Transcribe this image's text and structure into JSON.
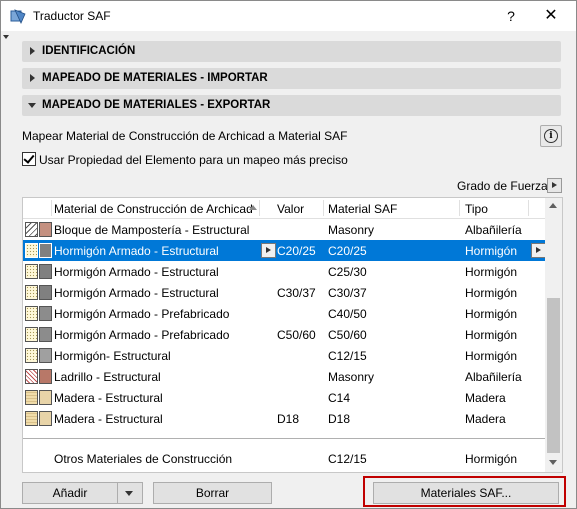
{
  "window": {
    "title": "Traductor SAF",
    "help_label": "?",
    "close_label": "✕"
  },
  "sections": [
    {
      "label": "IDENTIFICACIÓN",
      "expanded": false
    },
    {
      "label": "MAPEADO DE MATERIALES - IMPORTAR",
      "expanded": false
    },
    {
      "label": "MAPEADO DE MATERIALES - EXPORTAR",
      "expanded": true
    }
  ],
  "export": {
    "description": "Mapear Material de Construcción de Archicad a Material SAF",
    "info_icon": "i",
    "checkbox_label": "Usar Propiedad del Elemento para un mapeo más preciso",
    "checkbox_checked": true,
    "grado_label": "Grado de Fuerza"
  },
  "table": {
    "headers": {
      "material": "Material de Construcción de Archicad",
      "valor": "Valor",
      "saf": "Material SAF",
      "tipo": "Tipo"
    },
    "rows": [
      {
        "material": "Bloque de Mampostería - Estructural",
        "valor": "",
        "saf": "Masonry",
        "tipo": "Albañilería",
        "fill": "hatch",
        "color": "#c49080"
      },
      {
        "material": "Hormigón Armado - Estructural",
        "valor": "C20/25",
        "saf": "C20/25",
        "tipo": "Hormigón",
        "fill": "dots",
        "color": "#808080",
        "selected": true
      },
      {
        "material": "Hormigón Armado - Estructural",
        "valor": "",
        "saf": "C25/30",
        "tipo": "Hormigón",
        "fill": "dots",
        "color": "#808080"
      },
      {
        "material": "Hormigón Armado - Estructural",
        "valor": "C30/37",
        "saf": "C30/37",
        "tipo": "Hormigón",
        "fill": "dots",
        "color": "#808080"
      },
      {
        "material": "Hormigón Armado - Prefabricado",
        "valor": "",
        "saf": "C40/50",
        "tipo": "Hormigón",
        "fill": "dots",
        "color": "#8c8c8c"
      },
      {
        "material": "Hormigón Armado - Prefabricado",
        "valor": "C50/60",
        "saf": "C50/60",
        "tipo": "Hormigón",
        "fill": "dots",
        "color": "#8c8c8c"
      },
      {
        "material": "Hormigón- Estructural",
        "valor": "",
        "saf": "C12/15",
        "tipo": "Hormigón",
        "fill": "dots",
        "color": "#a0a0a0"
      },
      {
        "material": "Ladrillo - Estructural",
        "valor": "",
        "saf": "Masonry",
        "tipo": "Albañilería",
        "fill": "brickhatch",
        "color": "#b87868"
      },
      {
        "material": "Madera - Estructural",
        "valor": "",
        "saf": "C14",
        "tipo": "Madera",
        "fill": "wood",
        "color": "#e8d4a8"
      },
      {
        "material": "Madera - Estructural",
        "valor": "D18",
        "saf": "D18",
        "tipo": "Madera",
        "fill": "wood",
        "color": "#e8d4a8"
      }
    ],
    "other_row": {
      "material": "Otros Materiales de Construcción",
      "saf": "C12/15",
      "tipo": "Hormigón"
    }
  },
  "buttons": {
    "add": "Añadir",
    "delete": "Borrar",
    "saf_materials": "Materiales SAF..."
  },
  "colors": {
    "selection": "#0078d7",
    "highlight_border": "#c00000"
  }
}
